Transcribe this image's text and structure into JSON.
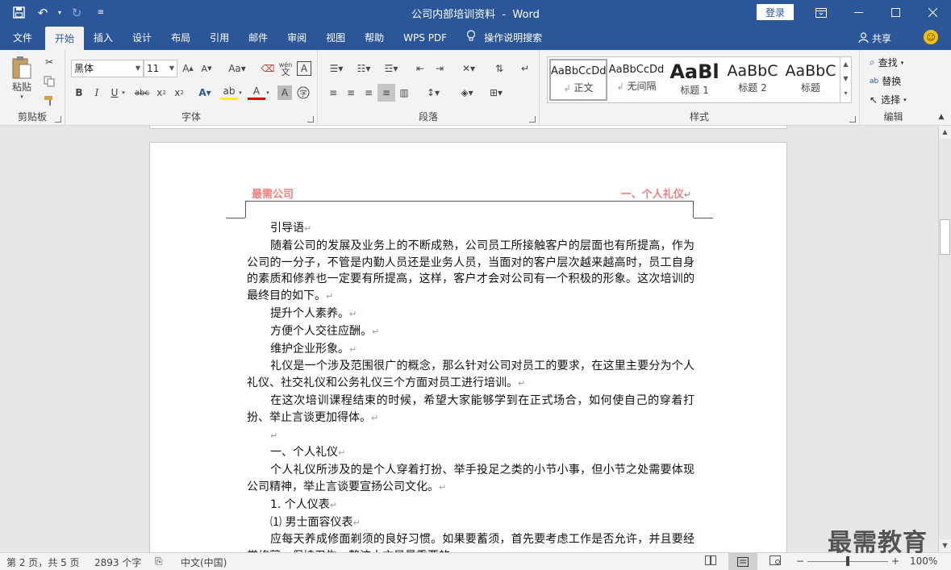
{
  "titlebar": {
    "doc_title": "公司内部培训资料",
    "separator": "-",
    "app_name": "Word",
    "login_label": "登录"
  },
  "tabs": [
    {
      "label": "文件"
    },
    {
      "label": "开始"
    },
    {
      "label": "插入"
    },
    {
      "label": "设计"
    },
    {
      "label": "布局"
    },
    {
      "label": "引用"
    },
    {
      "label": "邮件"
    },
    {
      "label": "审阅"
    },
    {
      "label": "视图"
    },
    {
      "label": "帮助"
    },
    {
      "label": "WPS PDF"
    },
    {
      "label": "操作说明搜索"
    }
  ],
  "active_tab": "开始",
  "share_label": "共享",
  "ribbon": {
    "clipboard": {
      "label": "剪贴板",
      "paste_label": "粘贴"
    },
    "font": {
      "label": "字体",
      "font_name": "黑体",
      "font_size": "11",
      "phonetic_label": "wén"
    },
    "paragraph": {
      "label": "段落"
    },
    "styles": {
      "label": "样式",
      "items": [
        {
          "preview": "AaBbCcDd",
          "name": "正文",
          "selected": true
        },
        {
          "preview": "AaBbCcDd",
          "name": "无间隔",
          "selected": false
        },
        {
          "preview": "AaBl",
          "name": "标题 1",
          "selected": false
        },
        {
          "preview": "AaBbC",
          "name": "标题 2",
          "selected": false
        },
        {
          "preview": "AaBbC",
          "name": "标题",
          "selected": false
        }
      ]
    },
    "editing": {
      "label": "编辑",
      "find_label": "查找",
      "replace_label": "替换",
      "select_label": "选择"
    }
  },
  "document": {
    "header_left": "最需公司",
    "header_right": "一、个人礼仪",
    "paragraphs": [
      "引导语",
      "随着公司的发展及业务上的不断成熟，公司员工所接触客户的层面也有所提高，作为公司的一分子，不管是内勤人员还是业务人员，当面对的客户层次越来越高时，员工自身的素质和修养也一定要有所提高，这样，客户才会对公司有一个积极的形象。这次培训的最终目的如下。",
      "提升个人素养。",
      "方便个人交往应酬。",
      "维护企业形象。",
      "礼仪是一个涉及范围很广的概念，那么针对公司对员工的要求，在这里主要分为个人礼仪、社交礼仪和公务礼仪三个方面对员工进行培训。",
      "在这次培训课程结束的时候，希望大家能够学到在正式场合，如何使自己的穿着打扮、举止言谈更加得体。",
      "",
      "一、个人礼仪",
      "个人礼仪所涉及的是个人穿着打扮、举手投足之类的小节小事，但小节之处需要体现公司精神，举止言谈要宣扬公司文化。",
      "1.  个人仪表",
      "⑴ 男士面容仪表",
      "应每天养成修面剃须的良好习惯。如果要蓄须，首先要考虑工作是否允许，并且要经常修剪，保持卫生，整洁大方是最重要的。"
    ],
    "para_mark": "↵"
  },
  "statusbar": {
    "page_info": "第 2 页，共 5 页",
    "word_count": "2893 个字",
    "language": "中文(中国)",
    "zoom_minus": "−",
    "zoom_plus": "+",
    "zoom": "100%"
  },
  "watermark": "最需教育"
}
